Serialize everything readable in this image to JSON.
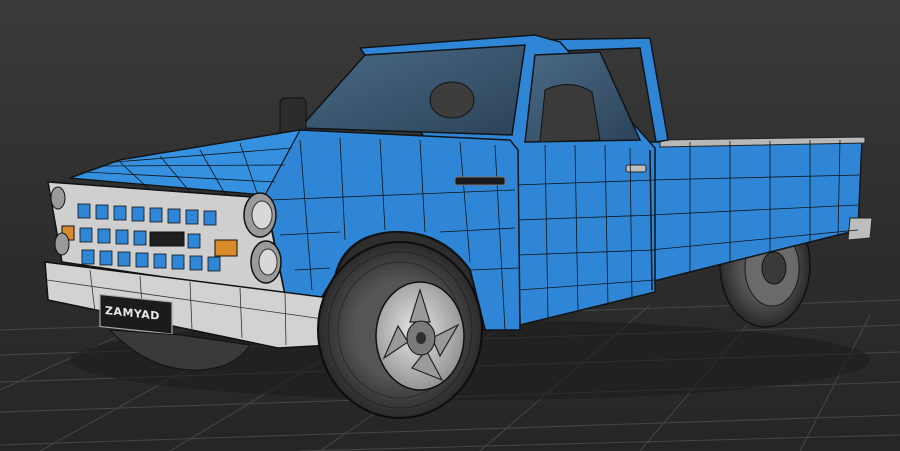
{
  "scene": {
    "subject": "pickup-truck-wireframe-model",
    "background_color": "#2b2b2b",
    "grid_color": "#4a4a4a",
    "body_color": "#2f86d6",
    "wire_color": "#101418",
    "chrome_color": "#c9c9c9",
    "tire_color": "#3a3a3a"
  },
  "truck": {
    "plate_text": "ZAMYAD"
  }
}
